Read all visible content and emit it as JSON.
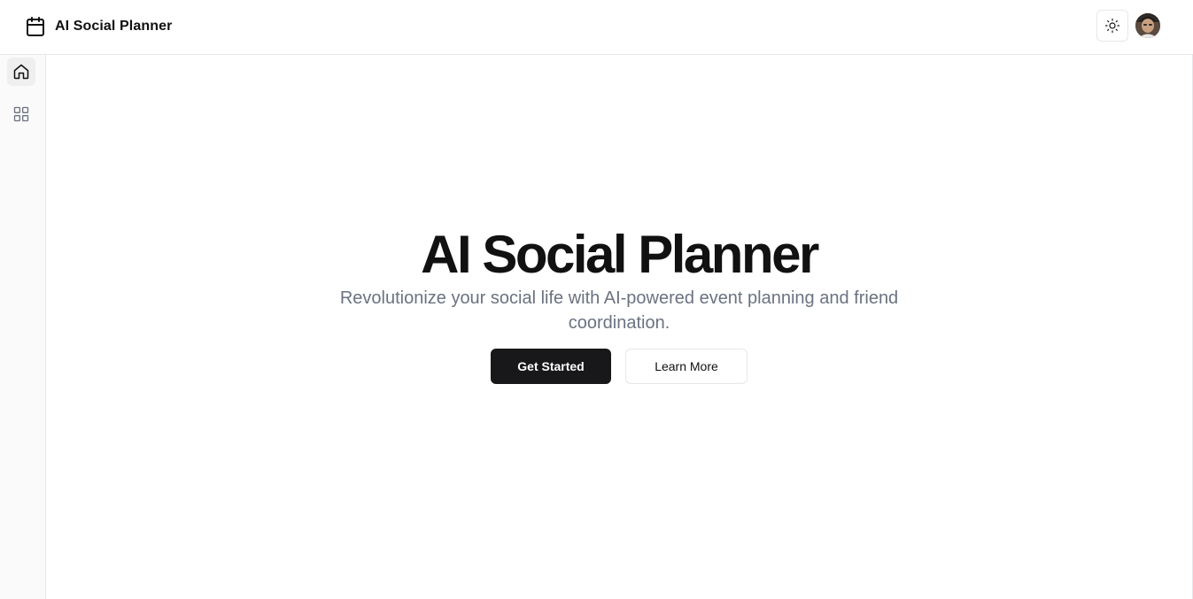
{
  "header": {
    "brand_title": "AI Social Planner",
    "brand_icon": "calendar-icon",
    "theme_toggle_icon": "sun-icon",
    "avatar": "user-avatar"
  },
  "sidebar": {
    "items": [
      {
        "name": "home",
        "icon": "home-icon",
        "active": true
      },
      {
        "name": "dashboard",
        "icon": "grid-icon",
        "active": false
      }
    ]
  },
  "hero": {
    "title": "AI Social Planner",
    "subtitle": "Revolutionize your social life with AI-powered event planning and friend coordination.",
    "primary_button": "Get Started",
    "secondary_button": "Learn More"
  },
  "colors": {
    "primary_button_bg": "#18181b",
    "subtitle_text": "#6b7280",
    "border": "#e5e7eb",
    "sidebar_bg": "#fafafa"
  }
}
